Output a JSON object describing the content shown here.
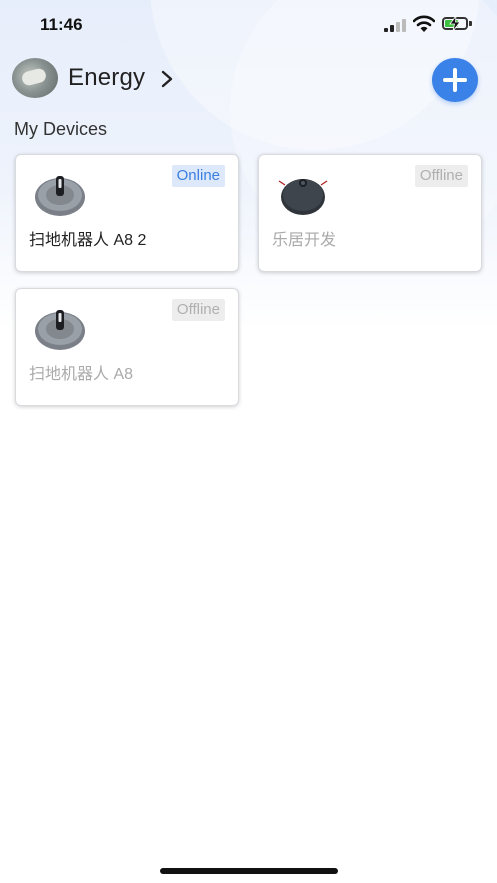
{
  "status_bar": {
    "time": "11:46"
  },
  "header": {
    "home_name": "Energy"
  },
  "section": {
    "title": "My Devices"
  },
  "devices": [
    {
      "name": "扫地机器人 A8 2",
      "status": "Online",
      "icon": "robot-vacuum-a8-icon"
    },
    {
      "name": "乐居开发",
      "status": "Offline",
      "icon": "robot-vacuum-dark-icon"
    },
    {
      "name": "扫地机器人 A8",
      "status": "Offline",
      "icon": "robot-vacuum-a8-icon"
    }
  ],
  "colors": {
    "accent": "#3b82e8",
    "online_badge_bg": "#dde9fa",
    "online_badge_text": "#3b7ee0",
    "offline_badge_bg": "#ededed",
    "offline_text": "#b0b0b0"
  }
}
